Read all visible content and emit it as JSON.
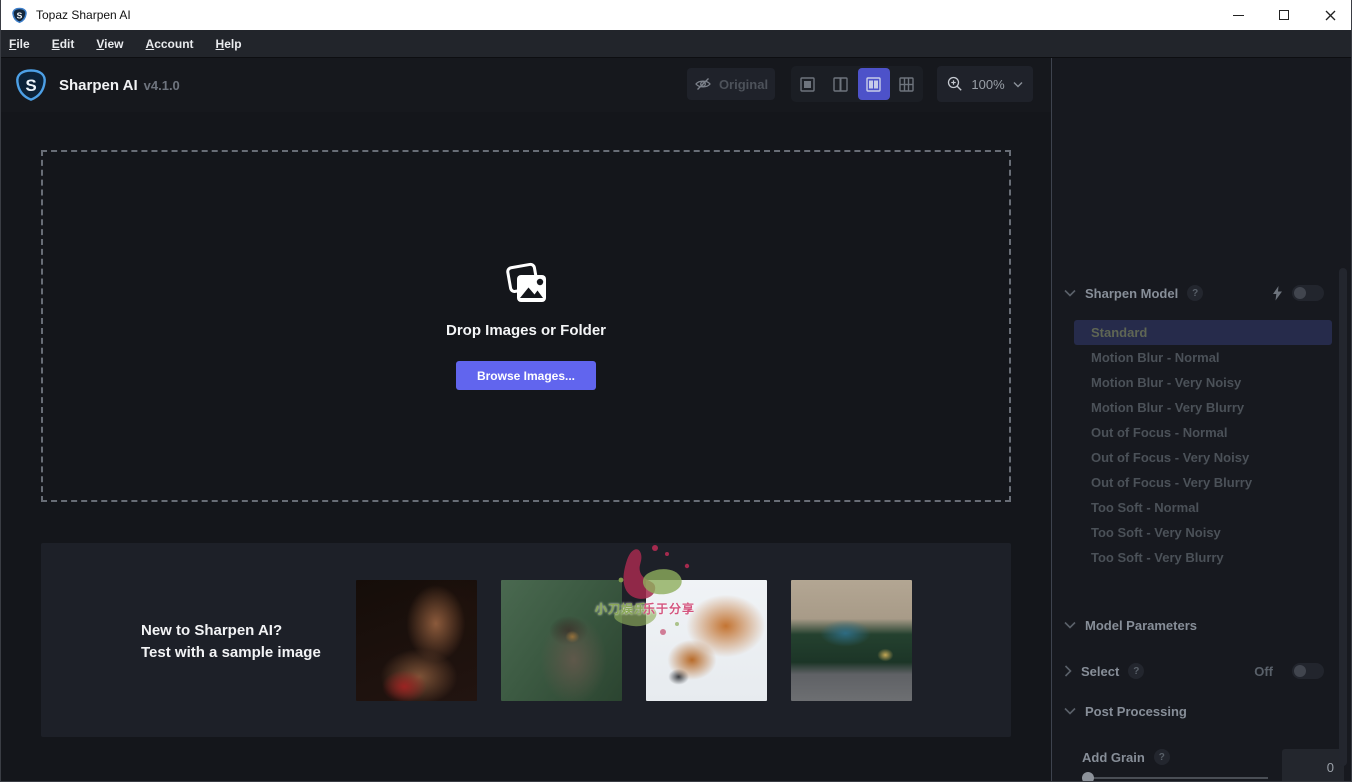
{
  "window": {
    "title": "Topaz Sharpen AI"
  },
  "menubar": {
    "items": [
      {
        "label": "File"
      },
      {
        "label": "Edit"
      },
      {
        "label": "View"
      },
      {
        "label": "Account"
      },
      {
        "label": "Help"
      }
    ]
  },
  "header": {
    "logo_letter": "S",
    "app_name": "Sharpen AI",
    "version": "v4.1.0",
    "original_button": {
      "label": "Original",
      "enabled": false
    },
    "zoom": {
      "level": "100%"
    }
  },
  "dropzone": {
    "title": "Drop Images or Folder",
    "browse_button_label": "Browse Images..."
  },
  "samples": {
    "heading_line1": "New to Sharpen AI?",
    "heading_line2": "Test with a sample image",
    "thumbnails": [
      {
        "name": "portrait-sample"
      },
      {
        "name": "owl-sample"
      },
      {
        "name": "fox-sample"
      },
      {
        "name": "car-sample"
      }
    ]
  },
  "watermark": {
    "text_left": "小刀娱乐",
    "text_right": "乐于分享"
  },
  "sidebar": {
    "sharpen_model": {
      "label": "Sharpen Model",
      "help_badge": "?",
      "auto_toggle_state": "off",
      "models": [
        {
          "label": "Standard",
          "selected": true
        },
        {
          "label": "Motion Blur - Normal"
        },
        {
          "label": "Motion Blur - Very Noisy"
        },
        {
          "label": "Motion Blur - Very Blurry"
        },
        {
          "label": "Out of Focus - Normal"
        },
        {
          "label": "Out of Focus - Very Noisy"
        },
        {
          "label": "Out of Focus - Very Blurry"
        },
        {
          "label": "Too Soft - Normal"
        },
        {
          "label": "Too Soft - Very Noisy"
        },
        {
          "label": "Too Soft - Very Blurry"
        }
      ]
    },
    "model_parameters": {
      "label": "Model Parameters"
    },
    "select_section": {
      "label": "Select",
      "help_badge": "?",
      "state_label": "Off",
      "toggle_state": "off"
    },
    "post_processing": {
      "label": "Post Processing"
    },
    "add_grain": {
      "label": "Add Grain",
      "help_badge": "?",
      "value": "0",
      "slider_position": 0
    }
  },
  "icons": [
    "app-shield-icon",
    "minimize-icon",
    "maximize-icon",
    "close-icon",
    "eye-off-icon",
    "view-single-icon",
    "view-split-icon",
    "view-side-by-side-icon",
    "view-comparison-icon",
    "zoom-in-icon",
    "chevron-down-icon",
    "chevron-right-icon",
    "photos-icon",
    "lightning-icon",
    "help-icon"
  ],
  "colors": {
    "accent_indigo": "#6165ee",
    "selected_view_button": "#4d52c9",
    "selected_model_row": "#262b4b",
    "titlebar_bg": "#ffffff",
    "panel_bg": "#1d2028",
    "app_bg": "#14161b"
  }
}
